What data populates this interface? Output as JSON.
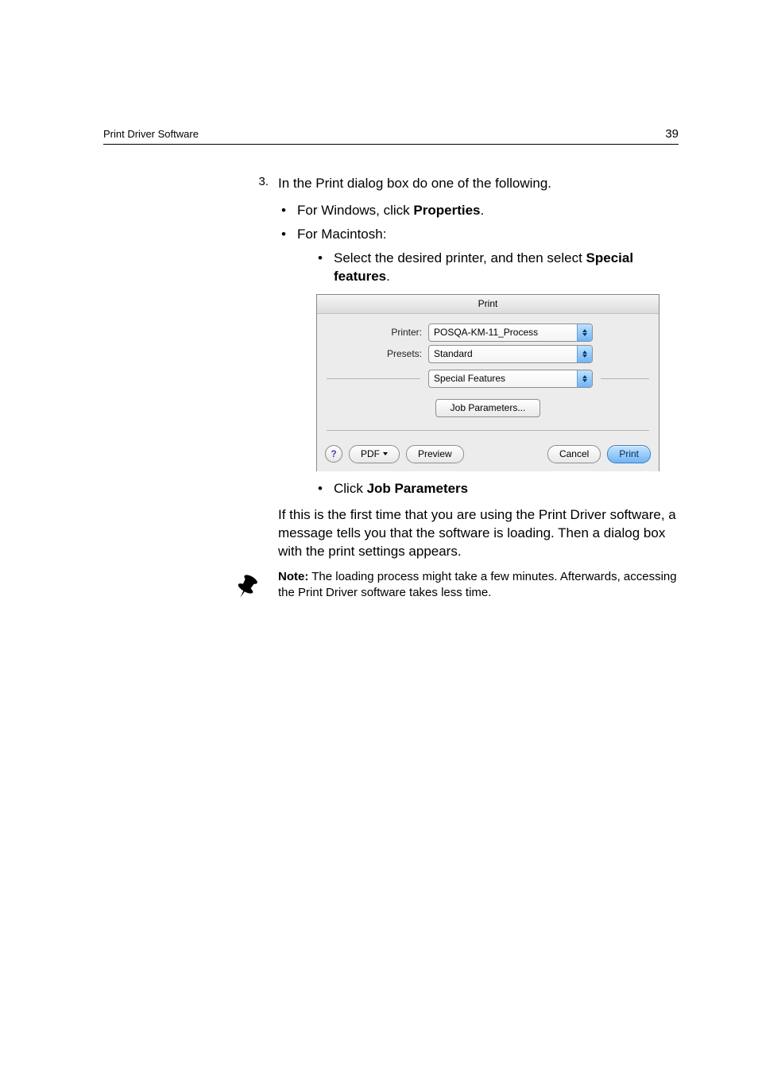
{
  "header": {
    "section": "Print Driver Software",
    "page": "39"
  },
  "step": {
    "number": "3.",
    "text": "In the Print dialog box do one of the following."
  },
  "bullets": {
    "win_prefix": "For Windows, click ",
    "win_bold": "Properties",
    "win_suffix": ".",
    "mac": "For Macintosh:",
    "mac_sub_prefix": "Select the desired printer, and then select ",
    "mac_sub_bold": "Special features",
    "mac_sub_suffix": ".",
    "click_prefix": "Click ",
    "click_bold": "Job Parameters"
  },
  "dialog": {
    "title": "Print",
    "printer_label": "Printer:",
    "printer_value": "POSQA-KM-11_Process",
    "presets_label": "Presets:",
    "presets_value": "Standard",
    "pane_value": "Special Features",
    "job_button": "Job Parameters...",
    "help": "?",
    "pdf": "PDF",
    "preview": "Preview",
    "cancel": "Cancel",
    "print": "Print"
  },
  "paragraph": "If this is the first time that you are using the Print Driver software, a message tells you that the software is loading. Then a dialog box with the print settings appears.",
  "note": {
    "label": "Note:",
    "text": "  The loading process might take a few minutes. Afterwards, accessing the Print Driver software takes less time."
  }
}
